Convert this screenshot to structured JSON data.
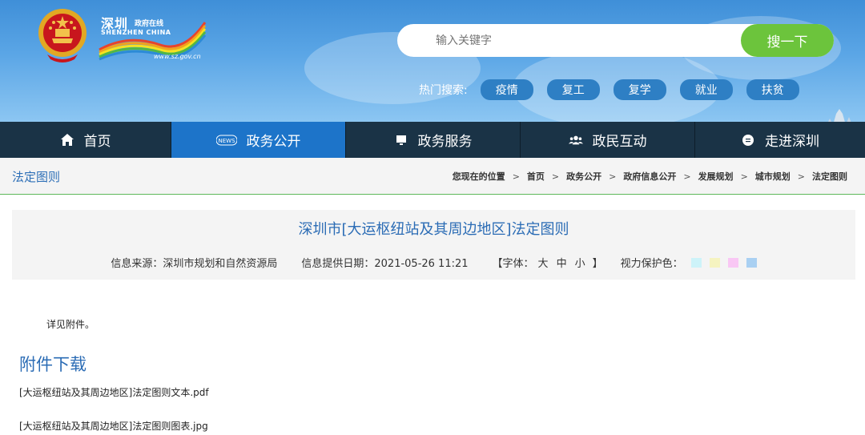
{
  "header": {
    "logo_cn": "深圳",
    "logo_cn_sub": "政府在线",
    "logo_en": "SHENZHEN CHINA",
    "logo_url": "www.sz.gov.cn"
  },
  "search": {
    "placeholder": "输入关键字",
    "button_label": "搜一下"
  },
  "hot_search": {
    "label": "热门搜索:",
    "tags": [
      "疫情",
      "复工",
      "复学",
      "就业",
      "扶贫"
    ]
  },
  "nav": {
    "items": [
      {
        "label": "首页",
        "icon": "home-icon"
      },
      {
        "label": "政务公开",
        "icon": "news-icon",
        "active": true
      },
      {
        "label": "政务服务",
        "icon": "monitor-icon"
      },
      {
        "label": "政民互动",
        "icon": "people-icon"
      },
      {
        "label": "走进深圳",
        "icon": "chat-icon"
      }
    ]
  },
  "breadcrumb": {
    "section_title": "法定图则",
    "items": [
      "您现在的位置",
      "首页",
      "政务公开",
      "政府信息公开",
      "发展规划",
      "城市规划",
      "法定图则"
    ],
    "separator": ">"
  },
  "article": {
    "title": "深圳市[大运枢纽站及其周边地区]法定图则",
    "source": "信息来源：深圳市规划和自然资源局",
    "date": "信息提供日期：2021-05-26 11:21",
    "font_label": "【字体：",
    "font_large": "大",
    "font_medium": "中",
    "font_small": "小",
    "font_close": "】",
    "eye_label": "视力保护色：",
    "eye_colors": [
      "#cdf3f9",
      "#f5f3c0",
      "#f9c7f4",
      "#a9d0f2"
    ],
    "body": "详见附件。",
    "attachments_title": "附件下载",
    "attachments": [
      "[大运枢纽站及其周边地区]法定图则文本.pdf",
      "[大运枢纽站及其周边地区]法定图则图表.jpg"
    ]
  },
  "colors": {
    "accent_blue": "#2b6cb5",
    "nav_bg": "#1a3346",
    "nav_active": "#1d74c9",
    "search_button": "#6cc43c",
    "hot_tag": "#2e7fc4"
  }
}
